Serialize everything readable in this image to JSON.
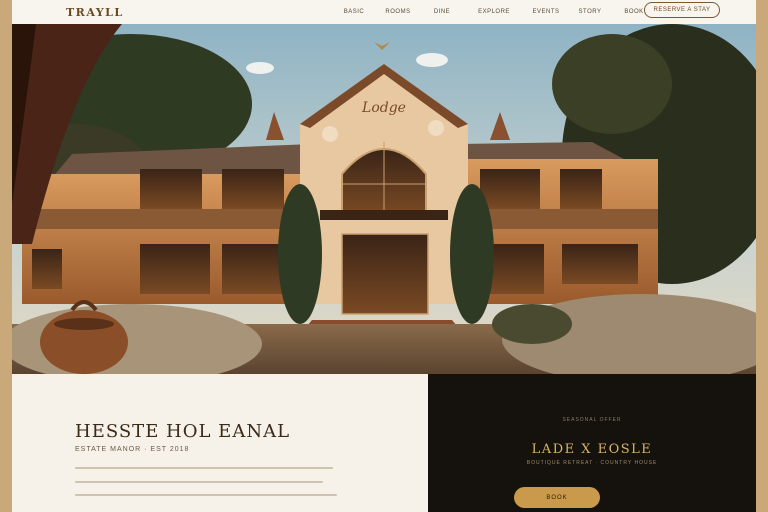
{
  "nav": {
    "brand": "TRAYLL",
    "links": [
      "BASIC",
      "ROOMS",
      "DINE",
      "EXPLORE",
      "EVENTS",
      "STORY",
      "BOOK"
    ],
    "cta_label": "RESERVE A STAY"
  },
  "hero": {
    "signage_text": "Lodge"
  },
  "intro": {
    "title": "HESSTE HOL EANAL",
    "subtitle": "ESTATE MANOR · EST 2018"
  },
  "side": {
    "kicker": "SEASONAL OFFER",
    "title": "LADE X EOSLE",
    "meta": "BOUTIQUE RETREAT · COUNTRY HOUSE",
    "button_label": "BOOK"
  },
  "colors": {
    "accent": "#c99a4c",
    "dark_panel": "#15110d",
    "light_panel": "#f6f1e9",
    "brand_text": "#6b4a22"
  }
}
